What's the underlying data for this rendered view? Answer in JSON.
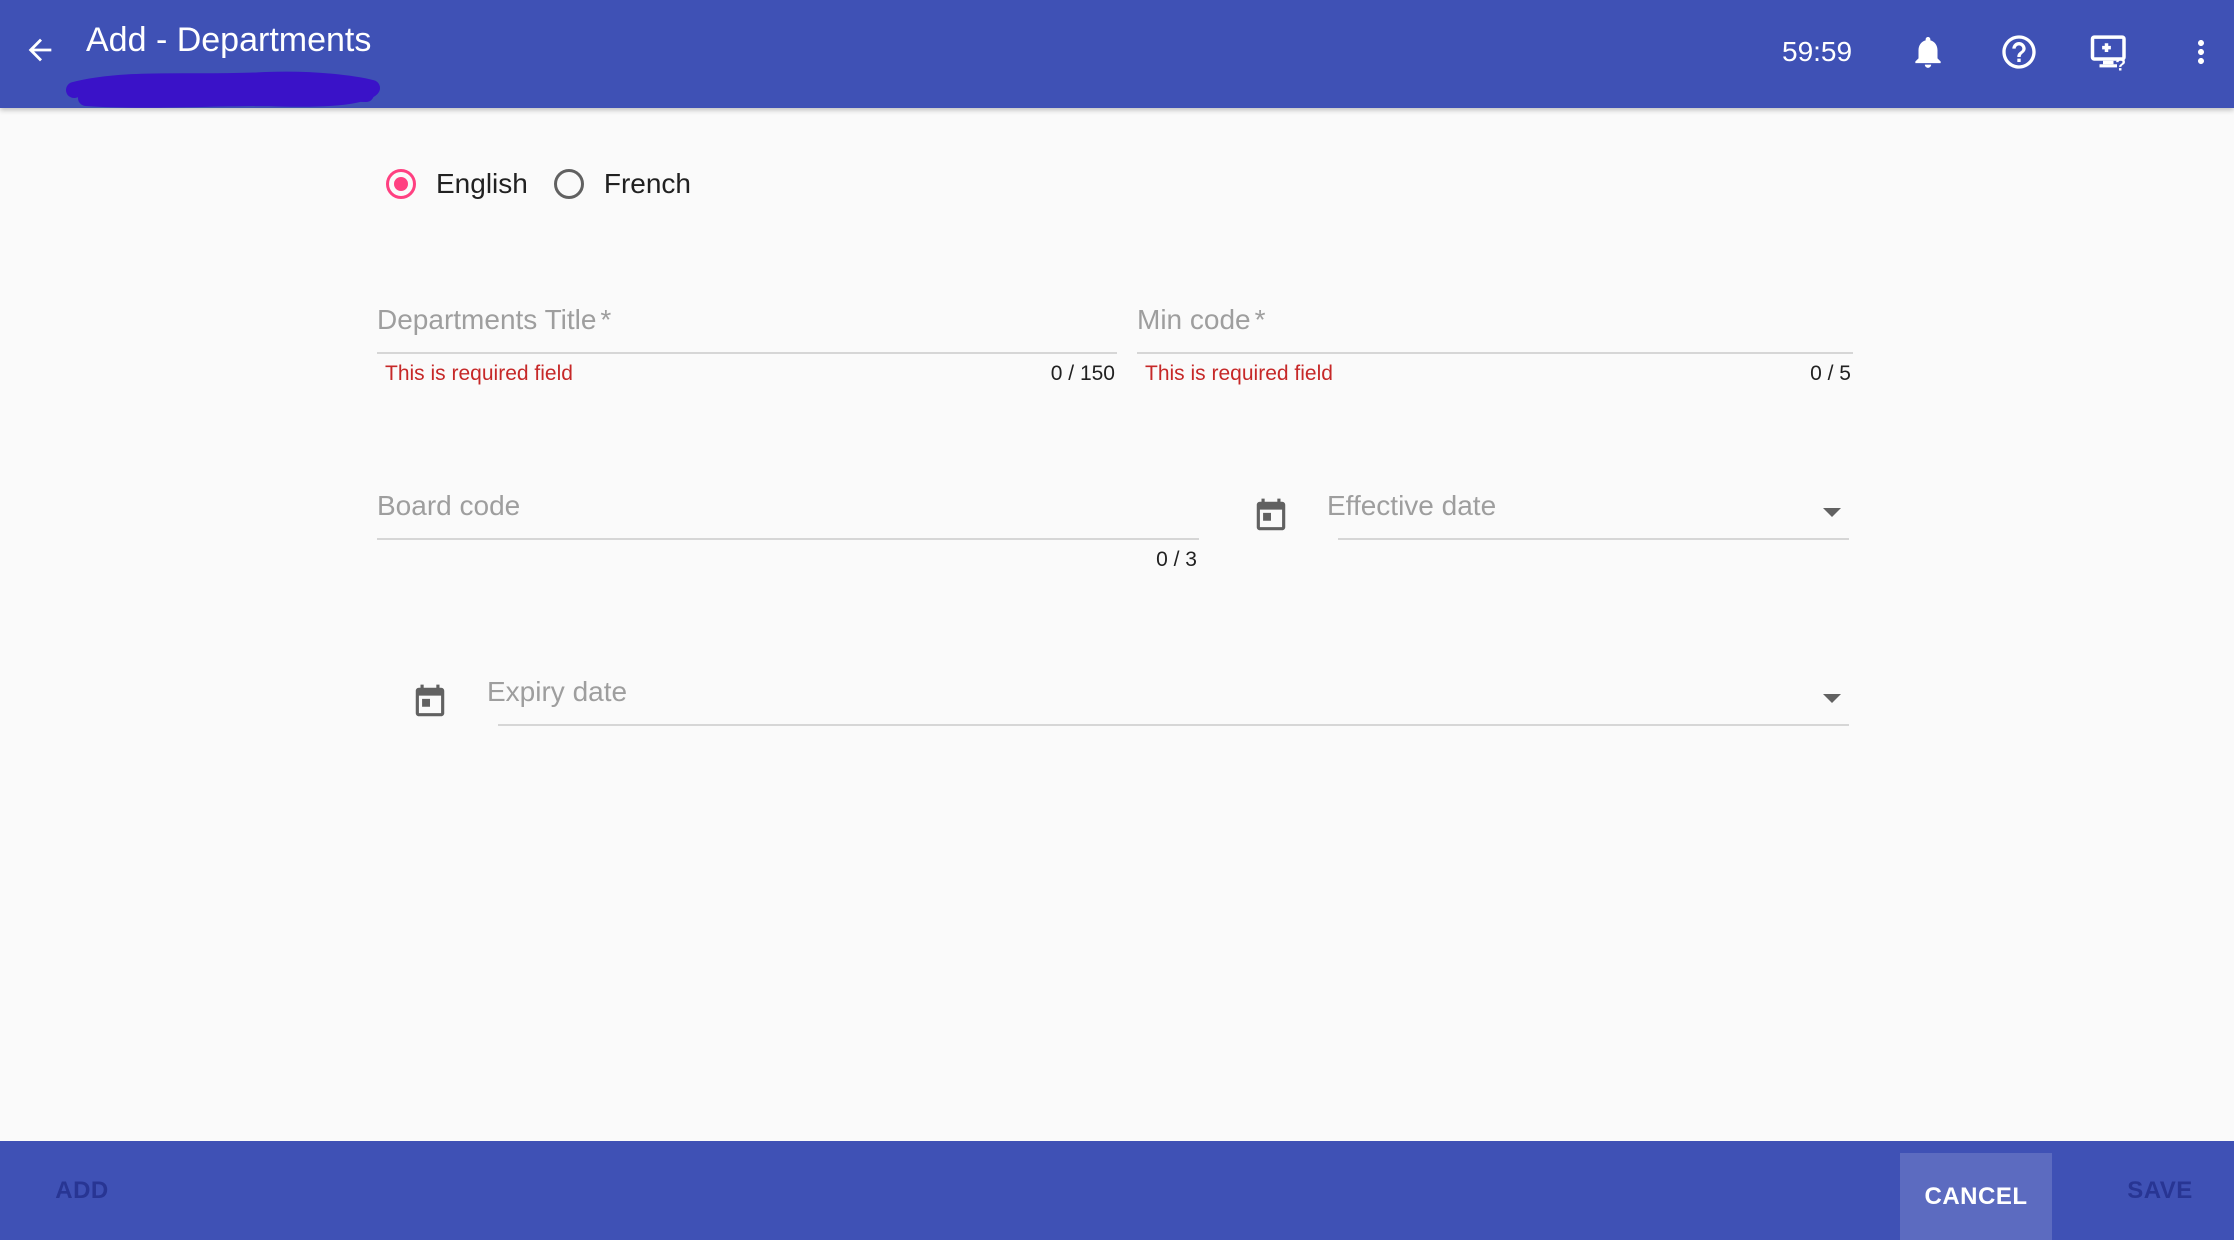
{
  "header": {
    "title": "Add - Departments",
    "timer": "59:59",
    "icons": [
      "back-arrow-icon",
      "bell-icon",
      "help-circle-icon",
      "screen-help-icon",
      "more-vert-icon"
    ]
  },
  "language": {
    "options": [
      {
        "label": "English",
        "checked": true
      },
      {
        "label": "French",
        "checked": false
      }
    ]
  },
  "form": {
    "department_title": {
      "label": "Departments Title",
      "required_mark": "*",
      "error": "This is required field",
      "counter": "0 / 150"
    },
    "min_code": {
      "label": "Min code",
      "required_mark": "*",
      "error": "This is required field",
      "counter": "0 / 5"
    },
    "board_code": {
      "label": "Board code",
      "counter": "0 / 3"
    },
    "effective_date": {
      "label": "Effective date"
    },
    "expiry_date": {
      "label": "Expiry date"
    }
  },
  "footer": {
    "add_label": "ADD",
    "cancel_label": "CANCEL",
    "save_label": "SAVE"
  },
  "colors": {
    "primary": "#3f51b5",
    "accent": "#ff4081",
    "error": "#c62828"
  }
}
